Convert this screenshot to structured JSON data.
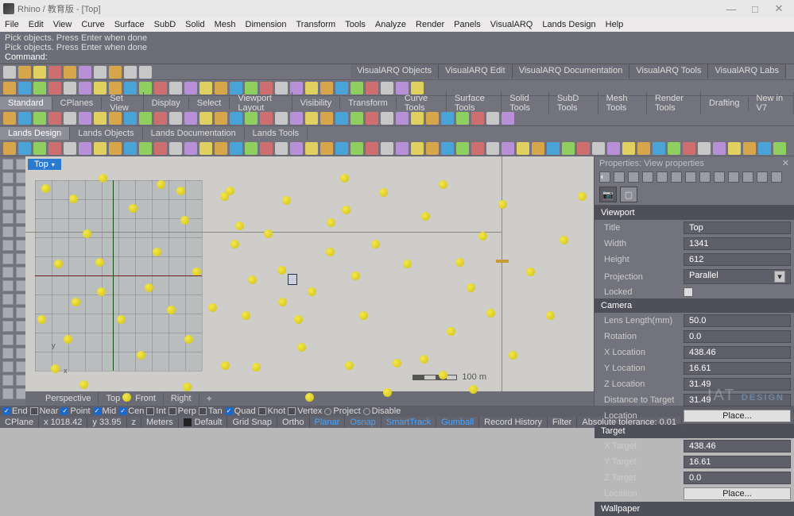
{
  "title": "Rhino / 教育版 - [Top]",
  "menu": [
    "File",
    "Edit",
    "View",
    "Curve",
    "Surface",
    "SubD",
    "Solid",
    "Mesh",
    "Dimension",
    "Transform",
    "Tools",
    "Analyze",
    "Render",
    "Panels",
    "VisualARQ",
    "Lands Design",
    "Help"
  ],
  "cmd": {
    "line1": "Pick objects. Press Enter when done",
    "line2": "Pick objects. Press Enter when done",
    "prompt": "Command:"
  },
  "vatabs": [
    "VisualARQ Objects",
    "VisualARQ Edit",
    "VisualARQ Documentation",
    "VisualARQ Tools",
    "VisualARQ Labs"
  ],
  "subtabs1": [
    "Standard",
    "CPlanes",
    "Set View",
    "Display",
    "Select",
    "Viewport Layout",
    "Visibility",
    "Transform",
    "Curve Tools",
    "Surface Tools",
    "Solid Tools",
    "SubD Tools",
    "Mesh Tools",
    "Render Tools",
    "Drafting",
    "New in V7"
  ],
  "subtabs2": [
    "Lands Design",
    "Lands Objects",
    "Lands Documentation",
    "Lands Tools"
  ],
  "viewport_label": "Top",
  "viewtabs": [
    "Perspective",
    "Top",
    "Front",
    "Right"
  ],
  "scale_label": "100 m",
  "properties": {
    "panel_title": "Properties: View properties",
    "sections": {
      "viewport": "Viewport",
      "camera": "Camera",
      "target": "Target",
      "wallpaper": "Wallpaper"
    },
    "viewport": {
      "Title": "Top",
      "Width": "1341",
      "Height": "612",
      "Projection": "Parallel",
      "Locked": ""
    },
    "camera": {
      "Lens Length(mm)": "50.0",
      "Rotation": "0.0",
      "X Location": "438.46",
      "Y Location": "16.61",
      "Z Location": "31.49",
      "Distance to Target": "31.49"
    },
    "target": {
      "X Target": "438.46",
      "Y Target": "16.61",
      "Z Target": "0.0"
    },
    "place_btn": "Place...",
    "location_lbl": "Location"
  },
  "snap": {
    "items": [
      {
        "label": "End",
        "on": true
      },
      {
        "label": "Near",
        "on": false
      },
      {
        "label": "Point",
        "on": true
      },
      {
        "label": "Mid",
        "on": true
      },
      {
        "label": "Cen",
        "on": true
      },
      {
        "label": "Int",
        "on": false
      },
      {
        "label": "Perp",
        "on": false
      },
      {
        "label": "Tan",
        "on": false
      },
      {
        "label": "Quad",
        "on": true
      },
      {
        "label": "Knot",
        "on": false
      },
      {
        "label": "Vertex",
        "on": false
      }
    ],
    "radios": [
      "Project",
      "Disable"
    ]
  },
  "status": {
    "cplane": "CPlane",
    "x": "x 1018.42",
    "y": "y 33.95",
    "z": "z",
    "units": "Meters",
    "layer": "Default",
    "items": [
      "Grid Snap",
      "Ortho",
      "Planar",
      "Osnap",
      "SmartTrack",
      "Gumball",
      "Record History",
      "Filter"
    ],
    "on": [
      "Planar",
      "Osnap",
      "SmartTrack",
      "Gumball"
    ],
    "tol": "Absolute tolerance: 0.01"
  },
  "watermark": "DESIGN"
}
